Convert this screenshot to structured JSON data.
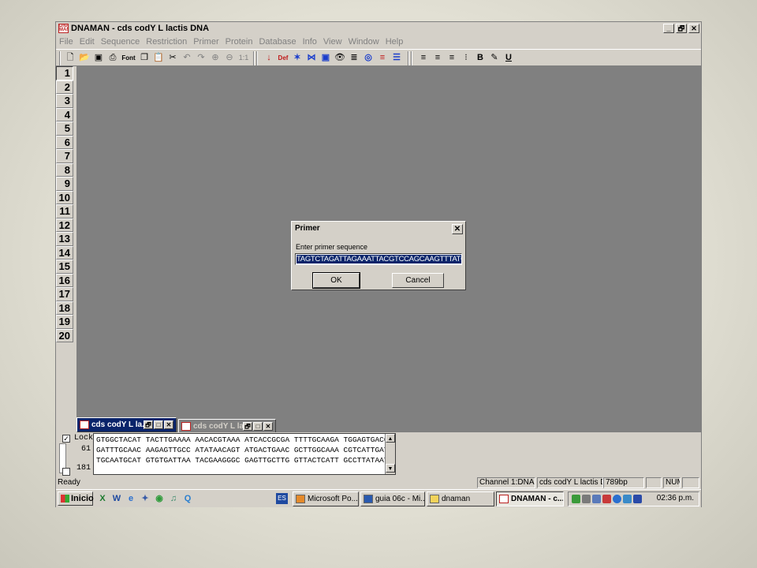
{
  "window": {
    "title": "DNAMAN - cds codY L lactis DNA",
    "icon_text": "DNA MAN",
    "caption_buttons": [
      "_",
      "🗗",
      "✕"
    ]
  },
  "menu": [
    "File",
    "Edit",
    "Sequence",
    "Restriction",
    "Primer",
    "Protein",
    "Database",
    "Info",
    "View",
    "Window",
    "Help"
  ],
  "toolbar": {
    "font_label": "Font",
    "zoom_label": "1:1",
    "def_label": "Def",
    "bold_label": "B",
    "underline_label": "U"
  },
  "line_numbers": [
    "1",
    "2",
    "3",
    "4",
    "5",
    "6",
    "7",
    "8",
    "9",
    "10",
    "11",
    "12",
    "13",
    "14",
    "15",
    "16",
    "17",
    "18",
    "19",
    "20"
  ],
  "mdi_minimized": [
    {
      "title": "cds codY L la..."
    },
    {
      "title": "cds codY L la..."
    }
  ],
  "sequence_panel": {
    "lock_label": "Lock",
    "positions": [
      "61",
      "181"
    ],
    "lines": [
      "GTGGCTACAT TACTTGAAAA AACACGTAAA ATCACCGCGA TTTTGCAAGA TGGAGTGACC",
      "GATTTGCAAC AAGAGTTGCC ATATAACAGT ATGACTGAAC GCTTGGCAAA CGTCATTGAT",
      "TGCAATGCAT GTGTGATTAA TACGAAGGGC GAGTTGCTTG GTTACTCATT GCCTTATAAT"
    ]
  },
  "dialog": {
    "title": "Primer",
    "label": "Enter primer sequence",
    "input_value": "TAGTCTAGATTAGAAATTACGTCCAGCAAGTTTATC",
    "ok_label": "OK",
    "cancel_label": "Cancel"
  },
  "statusbar": {
    "ready": "Ready",
    "channel": "Channel 1:DNA",
    "seqname": "cds codY L lactis DNA",
    "length": "789bp",
    "num": "NUM"
  },
  "taskbar": {
    "start_label": "Inicio",
    "lang": "ES",
    "tasks": [
      "Microsoft Po...",
      "guia 06c - Mi...",
      "dnaman",
      "DNAMAN - c..."
    ],
    "clock": "02:36 p.m."
  },
  "colors": {
    "workspace": "#808080",
    "selection": "#0a246a",
    "chrome": "#d4d0c8"
  }
}
